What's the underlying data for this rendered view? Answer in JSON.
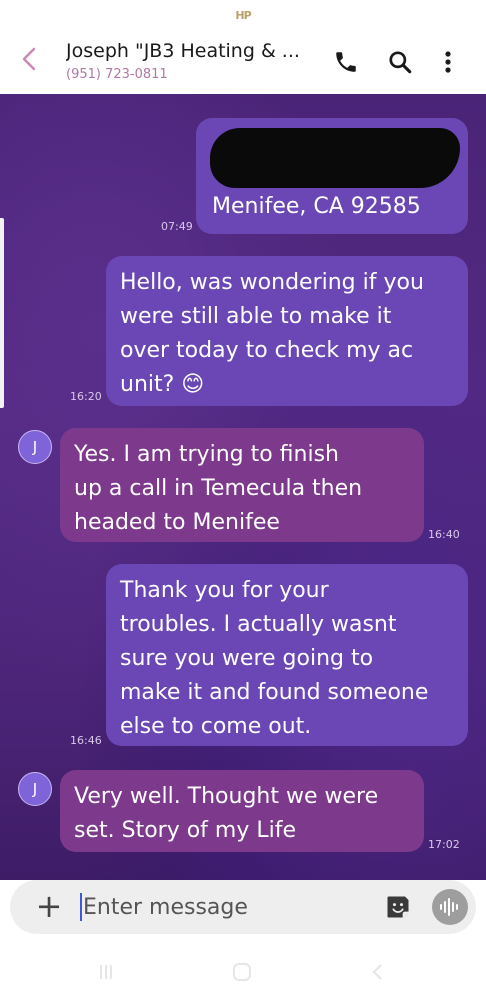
{
  "status_bar": {
    "icon": "HP"
  },
  "header": {
    "contact_name": "Joseph \"JB3 Heating & ...",
    "phone": "(951) 723-0811",
    "icons": [
      "back-icon",
      "phone-icon",
      "search-icon",
      "more-vert-icon"
    ]
  },
  "messages": [
    {
      "type": "sent",
      "lines": [
        "Menifee, CA 92585"
      ],
      "time": "07:49",
      "redacted": true
    },
    {
      "type": "sent",
      "lines": [
        "Hello, was wondering if you",
        "were still able to make it",
        "over today to check my ac",
        "unit? 😊"
      ],
      "time": "16:20"
    },
    {
      "type": "received",
      "avatar": "J",
      "lines": [
        "Yes. I am trying to finish",
        "up a call in Temecula then",
        "headed to Menifee"
      ],
      "time": "16:40"
    },
    {
      "type": "sent",
      "lines": [
        "Thank you for your",
        "troubles. I actually wasnt",
        "sure you were going to",
        "make it and found someone",
        "else to come out."
      ],
      "time": "16:46"
    },
    {
      "type": "received",
      "avatar": "J",
      "lines": [
        "Very well. Thought we were",
        "set. Story of my Life"
      ],
      "time": "17:02"
    }
  ],
  "compose": {
    "placeholder": "Enter message",
    "plus": "+",
    "icons": [
      "sticker-icon",
      "voice-icon"
    ]
  },
  "nav": {
    "icons": [
      "recents-icon",
      "home-icon",
      "back-nav-icon"
    ]
  },
  "colors": {
    "sent_bubble": "#6b47b5",
    "received_bubble": "#7d3a8c",
    "accent": "#c98bb2"
  }
}
